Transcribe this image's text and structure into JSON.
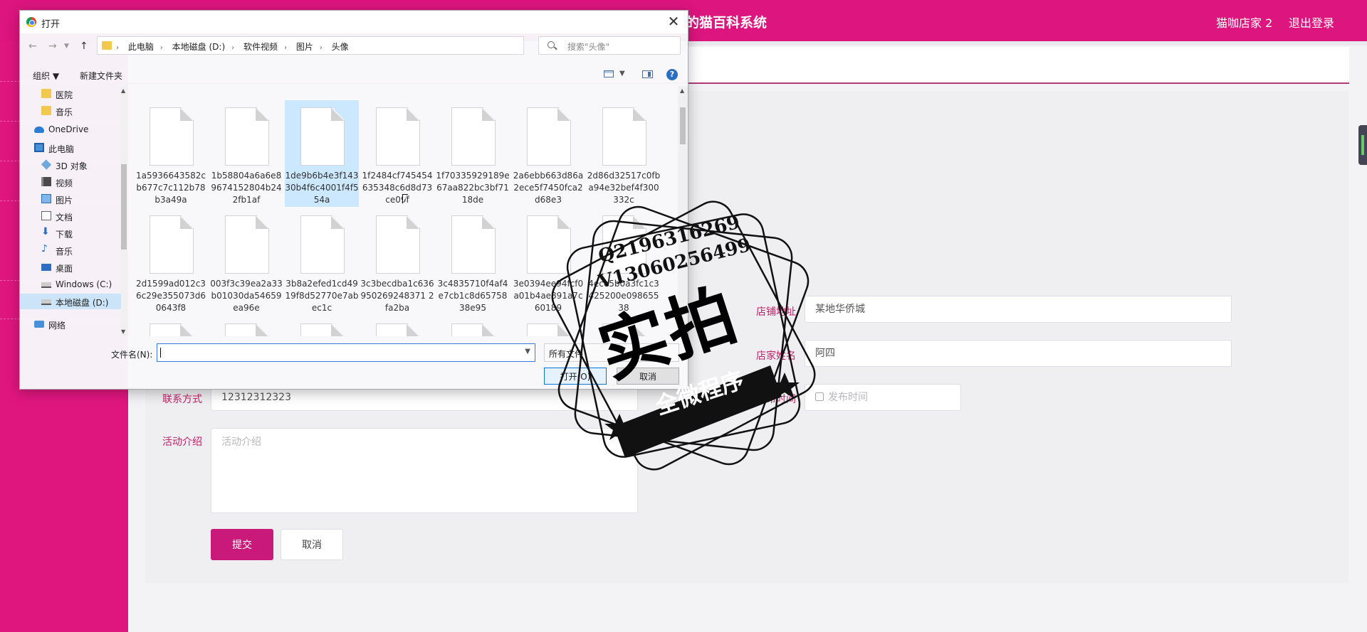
{
  "app": {
    "title": "基于微信小程序的猫百科系统",
    "user_name": "猫咖店家 2",
    "logout_label": "退出登录",
    "accent_color": "#dd157e"
  },
  "form": {
    "shop_address_label": "店铺地址",
    "shop_address_value": "某地华侨城",
    "shop_owner_label": "店家姓名",
    "shop_owner_value": "阿四",
    "contact_label": "联系方式",
    "contact_value": "12312312323",
    "publish_time_label": "发布时间",
    "publish_time_placeholder": "发布时间",
    "intro_label": "活动介绍",
    "intro_placeholder": "活动介绍",
    "submit_label": "提交",
    "cancel_label": "取消"
  },
  "dialog": {
    "title": "打开",
    "close_icon": "close-icon",
    "breadcrumbs": [
      "此电脑",
      "本地磁盘 (D:)",
      "软件视频",
      "图片",
      "头像"
    ],
    "search_placeholder": "搜索\"头像\"",
    "organize_label": "组织 ▼",
    "new_folder_label": "新建文件夹",
    "help_label": "?",
    "nav_items": [
      {
        "label": "医院",
        "icon": "folder-icon"
      },
      {
        "label": "音乐",
        "icon": "folder-icon"
      },
      {
        "label": "OneDrive",
        "icon": "cloud-icon"
      },
      {
        "label": "此电脑",
        "icon": "computer-icon"
      },
      {
        "label": "3D 对象",
        "icon": "cube-icon"
      },
      {
        "label": "视频",
        "icon": "video-icon"
      },
      {
        "label": "图片",
        "icon": "picture-icon"
      },
      {
        "label": "文档",
        "icon": "document-icon"
      },
      {
        "label": "下载",
        "icon": "download-icon"
      },
      {
        "label": "音乐",
        "icon": "music-icon"
      },
      {
        "label": "桌面",
        "icon": "desktop-icon"
      },
      {
        "label": "Windows (C:)",
        "icon": "drive-icon"
      },
      {
        "label": "本地磁盘 (D:)",
        "icon": "drive-icon"
      },
      {
        "label": "网络",
        "icon": "network-icon"
      }
    ],
    "files": [
      {
        "name": "1a5936643582cb677c7c112b78b3a49a"
      },
      {
        "name": "1b58804a6a6e89674152804b242fb1af"
      },
      {
        "name": "1de9b6b4e3f14330b4f6c4001f4f554a"
      },
      {
        "name": "1f2484cf745454635348c6d8d73ce09f"
      },
      {
        "name": "1f70335929189e67aa822bc3bf7118de"
      },
      {
        "name": "2a6ebb663d86a2ece5f7450fca2d68e3"
      },
      {
        "name": "2d86d32517c0fba94e32bef4f300332c"
      },
      {
        "name": "2d1599ad012c36c29e355073d60643f8"
      },
      {
        "name": "003f3c39ea2a33b01030da54659ea96e"
      },
      {
        "name": "3b8a2efed1cd4919f8d52770e7abec1c"
      },
      {
        "name": "3c3becdba1c636950269248371 2fa2ba"
      },
      {
        "name": "3c4835710f4af4e7cb1c8d6575838e95"
      },
      {
        "name": "3e0394ee94fcf0a01b4ae891a7c60189"
      },
      {
        "name": "4ece5b0a3fc1c3425200e09865538"
      }
    ],
    "filename_label": "文件名(N):",
    "filename_value": "",
    "filter_value": "所有文件",
    "open_label": "打开(O)",
    "cancel_label": "取消"
  },
  "watermark": {
    "qq": "Q2196316269",
    "wechat": "V13060256499",
    "big_text": "实拍",
    "band_text": "全微程序"
  }
}
